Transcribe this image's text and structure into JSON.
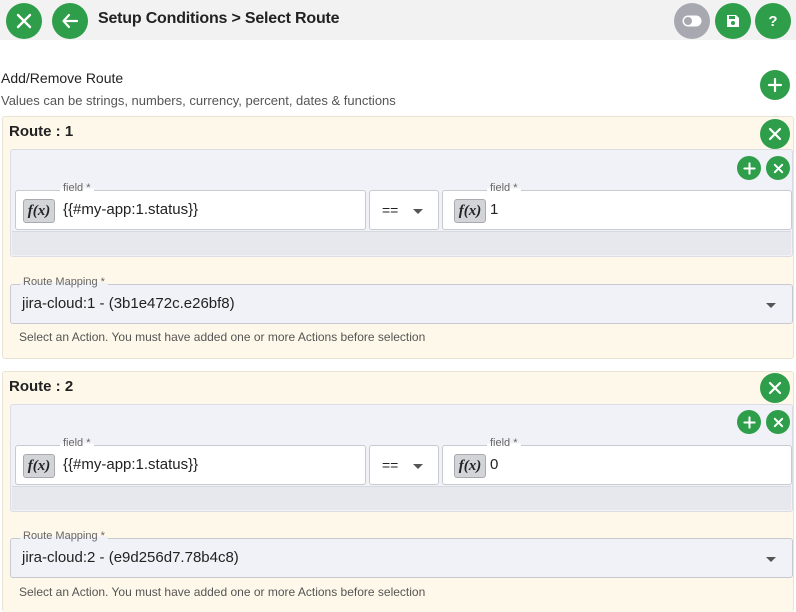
{
  "header": {
    "title": "Setup Conditions > Select Route",
    "close_icon": "close-icon",
    "back_icon": "arrow-left-icon",
    "toggle_icon": "toggle-icon",
    "save_icon": "save-icon",
    "help_icon": "?"
  },
  "section": {
    "title": "Add/Remove Route",
    "subtitle": "Values can be strings, numbers, currency, percent, dates & functions"
  },
  "colors": {
    "accent": "#2e9e4b",
    "card_bg": "#fef8ea",
    "toggle": "#a8a8b0"
  },
  "routes": [
    {
      "title": "Route : 1",
      "left_field": {
        "label": "field *",
        "fx": "f(x)",
        "value": "{{#my-app:1.status}}"
      },
      "operator": "==",
      "right_field": {
        "label": "field *",
        "fx": "f(x)",
        "value": "1"
      },
      "mapping": {
        "label": "Route Mapping *",
        "value": "jira-cloud:1 - (3b1e472c.e26bf8)",
        "help": "Select an Action. You must have added one or more Actions before selection"
      }
    },
    {
      "title": "Route : 2",
      "left_field": {
        "label": "field *",
        "fx": "f(x)",
        "value": "{{#my-app:1.status}}"
      },
      "operator": "==",
      "right_field": {
        "label": "field *",
        "fx": "f(x)",
        "value": "0"
      },
      "mapping": {
        "label": "Route Mapping *",
        "value": "jira-cloud:2 - (e9d256d7.78b4c8)",
        "help": "Select an Action. You must have added one or more Actions before selection"
      }
    }
  ]
}
